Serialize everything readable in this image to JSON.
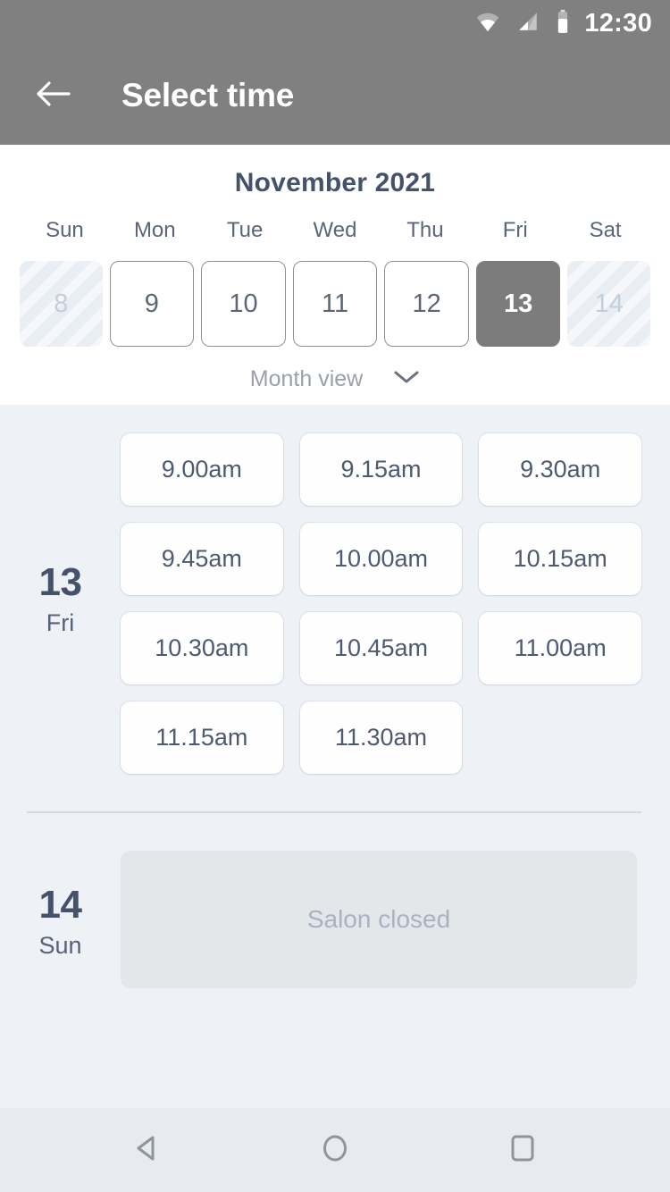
{
  "status_bar": {
    "time": "12:30",
    "icons": [
      "wifi-icon",
      "signal-icon",
      "battery-icon"
    ]
  },
  "app_bar": {
    "back_icon": "arrow-left-icon",
    "title": "Select time"
  },
  "calendar": {
    "month_title": "November 2021",
    "weekdays": [
      "Sun",
      "Mon",
      "Tue",
      "Wed",
      "Thu",
      "Fri",
      "Sat"
    ],
    "days": [
      {
        "num": "8",
        "state": "disabled"
      },
      {
        "num": "9",
        "state": "available"
      },
      {
        "num": "10",
        "state": "available"
      },
      {
        "num": "11",
        "state": "available"
      },
      {
        "num": "12",
        "state": "available"
      },
      {
        "num": "13",
        "state": "selected"
      },
      {
        "num": "14",
        "state": "disabled"
      }
    ],
    "month_view_label": "Month view",
    "month_view_icon": "chevron-down-icon"
  },
  "slots_section": {
    "day": {
      "num": "13",
      "dow": "Fri",
      "times": [
        "9.00am",
        "9.15am",
        "9.30am",
        "9.45am",
        "10.00am",
        "10.15am",
        "10.30am",
        "10.45am",
        "11.00am",
        "11.15am",
        "11.30am"
      ]
    },
    "closed_day": {
      "num": "14",
      "dow": "Sun",
      "message": "Salon closed"
    }
  },
  "nav_bar": {
    "buttons": [
      {
        "name": "back-nav-icon"
      },
      {
        "name": "home-nav-icon"
      },
      {
        "name": "recents-nav-icon"
      }
    ]
  },
  "colors": {
    "app_bar_bg": "#808080",
    "selected_day_bg": "#7c7c7c",
    "page_bg": "#eef1f6",
    "calendar_bg": "#ffffff",
    "text_dark": "#44526a",
    "closed_box_bg": "#e4e7ea",
    "nav_bar_bg": "#e7eaee"
  }
}
